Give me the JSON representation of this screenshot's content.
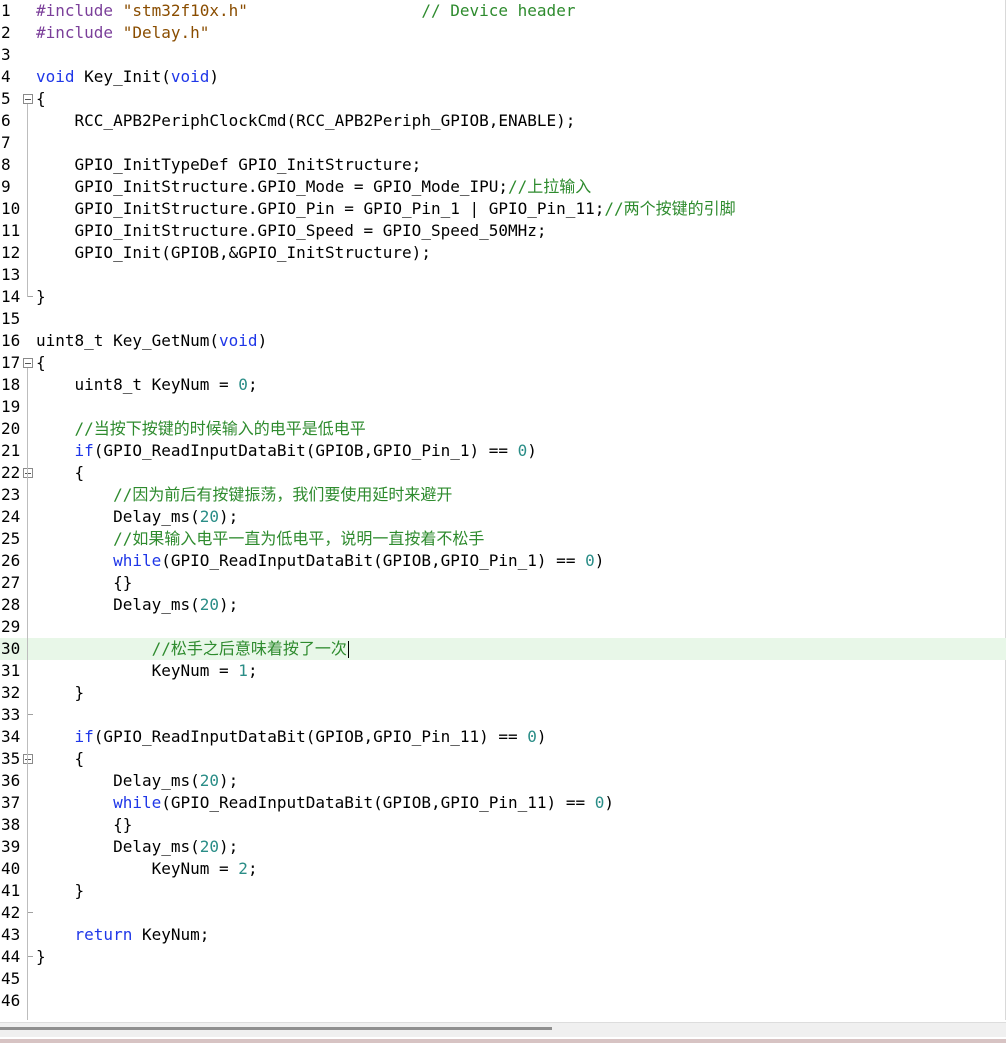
{
  "editor": {
    "active_line": 30,
    "lines": [
      {
        "n": "1",
        "tokens": [
          {
            "t": "#include ",
            "c": "tok-pre"
          },
          {
            "t": "\"stm32f10x.h\"",
            "c": "tok-str"
          },
          {
            "t": "                  ",
            "c": "tok-plain"
          },
          {
            "t": "// Device header",
            "c": "tok-cmt"
          }
        ]
      },
      {
        "n": "2",
        "tokens": [
          {
            "t": "#include ",
            "c": "tok-pre"
          },
          {
            "t": "\"Delay.h\"",
            "c": "tok-str"
          }
        ]
      },
      {
        "n": "3",
        "tokens": []
      },
      {
        "n": "4",
        "tokens": [
          {
            "t": "void",
            "c": "tok-kw"
          },
          {
            "t": " Key_Init(",
            "c": "tok-plain"
          },
          {
            "t": "void",
            "c": "tok-kw"
          },
          {
            "t": ")",
            "c": "tok-plain"
          }
        ]
      },
      {
        "n": "5",
        "tokens": [
          {
            "t": "{",
            "c": "tok-plain"
          }
        ]
      },
      {
        "n": "6",
        "tokens": [
          {
            "t": "    RCC_APB2PeriphClockCmd(RCC_APB2Periph_GPIOB,ENABLE);",
            "c": "tok-plain"
          }
        ]
      },
      {
        "n": "7",
        "tokens": []
      },
      {
        "n": "8",
        "tokens": [
          {
            "t": "    GPIO_InitTypeDef GPIO_InitStructure;",
            "c": "tok-plain"
          }
        ]
      },
      {
        "n": "9",
        "tokens": [
          {
            "t": "    GPIO_InitStructure.GPIO_Mode = GPIO_Mode_IPU;",
            "c": "tok-plain"
          },
          {
            "t": "//上拉输入",
            "c": "tok-cmt"
          }
        ]
      },
      {
        "n": "10",
        "tokens": [
          {
            "t": "    GPIO_InitStructure.GPIO_Pin = GPIO_Pin_1 | GPIO_Pin_11;",
            "c": "tok-plain"
          },
          {
            "t": "//两个按键的引脚",
            "c": "tok-cmt"
          }
        ]
      },
      {
        "n": "11",
        "tokens": [
          {
            "t": "    GPIO_InitStructure.GPIO_Speed = GPIO_Speed_50MHz;",
            "c": "tok-plain"
          }
        ]
      },
      {
        "n": "12",
        "tokens": [
          {
            "t": "    GPIO_Init(GPIOB,&GPIO_InitStructure);",
            "c": "tok-plain"
          }
        ]
      },
      {
        "n": "13",
        "tokens": []
      },
      {
        "n": "14",
        "tokens": [
          {
            "t": "}",
            "c": "tok-plain"
          }
        ]
      },
      {
        "n": "15",
        "tokens": []
      },
      {
        "n": "16",
        "tokens": [
          {
            "t": "uint8_t Key_GetNum(",
            "c": "tok-plain"
          },
          {
            "t": "void",
            "c": "tok-kw"
          },
          {
            "t": ")",
            "c": "tok-plain"
          }
        ]
      },
      {
        "n": "17",
        "tokens": [
          {
            "t": "{",
            "c": "tok-plain"
          }
        ]
      },
      {
        "n": "18",
        "tokens": [
          {
            "t": "    uint8_t KeyNum = ",
            "c": "tok-plain"
          },
          {
            "t": "0",
            "c": "tok-num"
          },
          {
            "t": ";",
            "c": "tok-plain"
          }
        ]
      },
      {
        "n": "19",
        "tokens": []
      },
      {
        "n": "20",
        "tokens": [
          {
            "t": "    ",
            "c": "tok-plain"
          },
          {
            "t": "//当按下按键的时候输入的电平是低电平",
            "c": "tok-cmt"
          }
        ]
      },
      {
        "n": "21",
        "tokens": [
          {
            "t": "    ",
            "c": "tok-plain"
          },
          {
            "t": "if",
            "c": "tok-kw"
          },
          {
            "t": "(GPIO_ReadInputDataBit(GPIOB,GPIO_Pin_1) == ",
            "c": "tok-plain"
          },
          {
            "t": "0",
            "c": "tok-num"
          },
          {
            "t": ")",
            "c": "tok-plain"
          }
        ]
      },
      {
        "n": "22",
        "tokens": [
          {
            "t": "    {",
            "c": "tok-plain"
          }
        ]
      },
      {
        "n": "23",
        "tokens": [
          {
            "t": "        ",
            "c": "tok-plain"
          },
          {
            "t": "//因为前后有按键振荡，我们要使用延时来避开",
            "c": "tok-cmt"
          }
        ]
      },
      {
        "n": "24",
        "tokens": [
          {
            "t": "        Delay_ms(",
            "c": "tok-plain"
          },
          {
            "t": "20",
            "c": "tok-num"
          },
          {
            "t": ");",
            "c": "tok-plain"
          }
        ]
      },
      {
        "n": "25",
        "tokens": [
          {
            "t": "        ",
            "c": "tok-plain"
          },
          {
            "t": "//如果输入电平一直为低电平，说明一直按着不松手",
            "c": "tok-cmt"
          }
        ]
      },
      {
        "n": "26",
        "tokens": [
          {
            "t": "        ",
            "c": "tok-plain"
          },
          {
            "t": "while",
            "c": "tok-kw"
          },
          {
            "t": "(GPIO_ReadInputDataBit(GPIOB,GPIO_Pin_1) == ",
            "c": "tok-plain"
          },
          {
            "t": "0",
            "c": "tok-num"
          },
          {
            "t": ")",
            "c": "tok-plain"
          }
        ]
      },
      {
        "n": "27",
        "tokens": [
          {
            "t": "        {}",
            "c": "tok-plain"
          }
        ]
      },
      {
        "n": "28",
        "tokens": [
          {
            "t": "        Delay_ms(",
            "c": "tok-plain"
          },
          {
            "t": "20",
            "c": "tok-num"
          },
          {
            "t": ");",
            "c": "tok-plain"
          }
        ]
      },
      {
        "n": "29",
        "tokens": []
      },
      {
        "n": "30",
        "tokens": [
          {
            "t": "            ",
            "c": "tok-plain"
          },
          {
            "t": "//松手之后意味着按了一次",
            "c": "tok-cmt"
          }
        ]
      },
      {
        "n": "31",
        "tokens": [
          {
            "t": "            KeyNum = ",
            "c": "tok-plain"
          },
          {
            "t": "1",
            "c": "tok-num"
          },
          {
            "t": ";",
            "c": "tok-plain"
          }
        ]
      },
      {
        "n": "32",
        "tokens": [
          {
            "t": "    }",
            "c": "tok-plain"
          }
        ]
      },
      {
        "n": "33",
        "tokens": []
      },
      {
        "n": "34",
        "tokens": [
          {
            "t": "    ",
            "c": "tok-plain"
          },
          {
            "t": "if",
            "c": "tok-kw"
          },
          {
            "t": "(GPIO_ReadInputDataBit(GPIOB,GPIO_Pin_11) == ",
            "c": "tok-plain"
          },
          {
            "t": "0",
            "c": "tok-num"
          },
          {
            "t": ")",
            "c": "tok-plain"
          }
        ]
      },
      {
        "n": "35",
        "tokens": [
          {
            "t": "    {",
            "c": "tok-plain"
          }
        ]
      },
      {
        "n": "36",
        "tokens": [
          {
            "t": "        Delay_ms(",
            "c": "tok-plain"
          },
          {
            "t": "20",
            "c": "tok-num"
          },
          {
            "t": ");",
            "c": "tok-plain"
          }
        ]
      },
      {
        "n": "37",
        "tokens": [
          {
            "t": "        ",
            "c": "tok-plain"
          },
          {
            "t": "while",
            "c": "tok-kw"
          },
          {
            "t": "(GPIO_ReadInputDataBit(GPIOB,GPIO_Pin_11) == ",
            "c": "tok-plain"
          },
          {
            "t": "0",
            "c": "tok-num"
          },
          {
            "t": ")",
            "c": "tok-plain"
          }
        ]
      },
      {
        "n": "38",
        "tokens": [
          {
            "t": "        {}",
            "c": "tok-plain"
          }
        ]
      },
      {
        "n": "39",
        "tokens": [
          {
            "t": "        Delay_ms(",
            "c": "tok-plain"
          },
          {
            "t": "20",
            "c": "tok-num"
          },
          {
            "t": ");",
            "c": "tok-plain"
          }
        ]
      },
      {
        "n": "40",
        "tokens": [
          {
            "t": "            KeyNum = ",
            "c": "tok-plain"
          },
          {
            "t": "2",
            "c": "tok-num"
          },
          {
            "t": ";",
            "c": "tok-plain"
          }
        ]
      },
      {
        "n": "41",
        "tokens": [
          {
            "t": "    }",
            "c": "tok-plain"
          }
        ]
      },
      {
        "n": "42",
        "tokens": []
      },
      {
        "n": "43",
        "tokens": [
          {
            "t": "    ",
            "c": "tok-plain"
          },
          {
            "t": "return",
            "c": "tok-kw"
          },
          {
            "t": " KeyNum;",
            "c": "tok-plain"
          }
        ]
      },
      {
        "n": "44",
        "tokens": [
          {
            "t": "}",
            "c": "tok-plain"
          }
        ]
      },
      {
        "n": "45",
        "tokens": []
      },
      {
        "n": "46",
        "tokens": []
      }
    ]
  }
}
